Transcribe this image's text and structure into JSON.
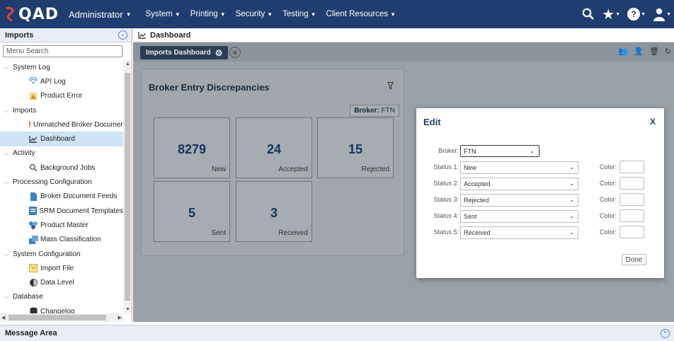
{
  "topbar": {
    "logo_text": "QAD",
    "role": "Administrator",
    "nav": [
      {
        "label": "System"
      },
      {
        "label": "Printing"
      },
      {
        "label": "Security"
      },
      {
        "label": "Testing"
      },
      {
        "label": "Client Resources"
      }
    ],
    "icons": [
      "search-icon",
      "star-icon",
      "help-icon",
      "user-icon"
    ],
    "help_glyph": "?"
  },
  "sidebar": {
    "title": "Imports",
    "search_placeholder": "Menu Search",
    "items": [
      {
        "label": "System Log",
        "type": "group"
      },
      {
        "label": "API Log",
        "type": "leaf",
        "icon": "api-log-icon"
      },
      {
        "label": "Product Error",
        "type": "leaf",
        "icon": "warning-icon"
      },
      {
        "label": "Imports",
        "type": "group"
      },
      {
        "label": "Unmatched Broker Documen",
        "type": "leaf",
        "icon": "exclamation-icon"
      },
      {
        "label": "Dashboard",
        "type": "leaf",
        "icon": "chart-line-icon",
        "selected": true
      },
      {
        "label": "Activity",
        "type": "group"
      },
      {
        "label": "Background Jobs",
        "type": "leaf",
        "icon": "search-jobs-icon"
      },
      {
        "label": "Processing Configuration",
        "type": "group"
      },
      {
        "label": "Broker Document Feeds",
        "type": "leaf",
        "icon": "document-icon"
      },
      {
        "label": "SRM Document Templates",
        "type": "leaf",
        "icon": "template-icon"
      },
      {
        "label": "Product Master",
        "type": "leaf",
        "icon": "product-master-icon"
      },
      {
        "label": "Mass Classification",
        "type": "leaf",
        "icon": "classification-icon"
      },
      {
        "label": "System Configuration",
        "type": "group"
      },
      {
        "label": "Import File",
        "type": "leaf",
        "icon": "import-file-icon"
      },
      {
        "label": "Data Level",
        "type": "leaf",
        "icon": "data-level-icon"
      },
      {
        "label": "Database",
        "type": "group"
      },
      {
        "label": "Changelog",
        "type": "leaf",
        "icon": "database-icon"
      }
    ]
  },
  "main": {
    "header_title": "Dashboard",
    "tab_label": "Imports Dashboard"
  },
  "widget": {
    "title": "Broker Entry Discrepancies",
    "broker_label": "Broker:",
    "broker_value": "FTN",
    "tiles": [
      {
        "value": "8279",
        "label": "New"
      },
      {
        "value": "24",
        "label": "Accepted"
      },
      {
        "value": "15",
        "label": "Rejected"
      },
      {
        "value": "5",
        "label": "Sent"
      },
      {
        "value": "3",
        "label": "Received"
      }
    ]
  },
  "modal": {
    "title": "Edit",
    "close": "X",
    "broker_label": "Broker:",
    "broker_value": "FTN",
    "color_label": "Color:",
    "statuses": [
      {
        "label": "Status 1:",
        "value": "New"
      },
      {
        "label": "Status 2:",
        "value": "Accepted"
      },
      {
        "label": "Status 3:",
        "value": "Rejected"
      },
      {
        "label": "Status 4:",
        "value": "Sent"
      },
      {
        "label": "Status 5:",
        "value": "Received"
      }
    ],
    "done_label": "Done"
  },
  "message_area": {
    "title": "Message Area"
  }
}
